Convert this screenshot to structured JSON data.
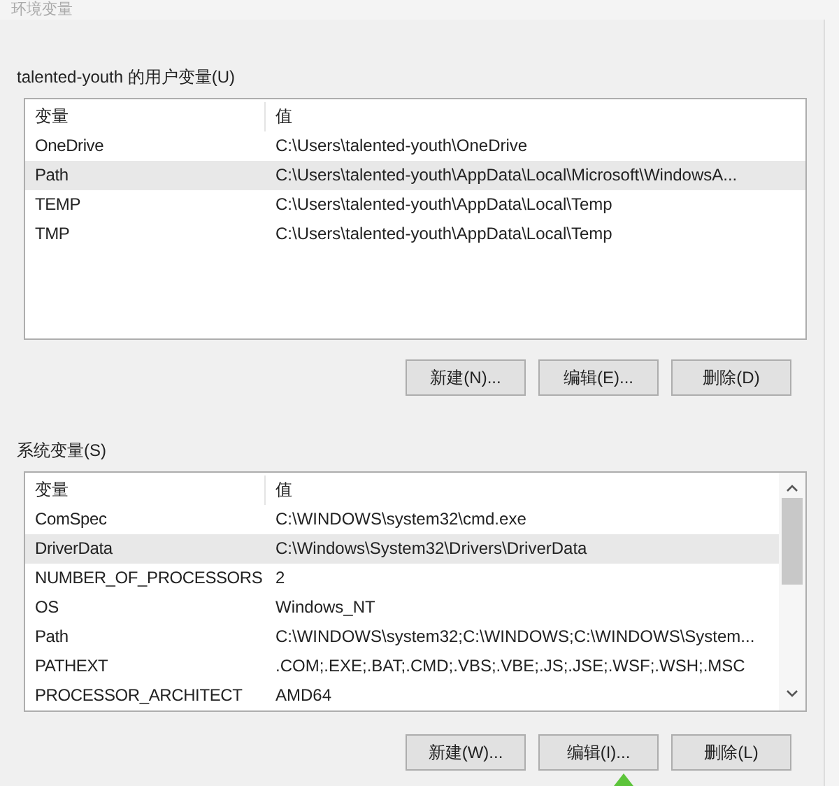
{
  "window": {
    "title": "环境变量"
  },
  "user_variables": {
    "label": "talented-youth 的用户变量(U)",
    "columns": [
      "变量",
      "值"
    ],
    "rows": [
      {
        "name": "OneDrive",
        "value": "C:\\Users\\talented-youth\\OneDrive",
        "selected": false
      },
      {
        "name": "Path",
        "value": "C:\\Users\\talented-youth\\AppData\\Local\\Microsoft\\WindowsA...",
        "selected": true
      },
      {
        "name": "TEMP",
        "value": "C:\\Users\\talented-youth\\AppData\\Local\\Temp",
        "selected": false
      },
      {
        "name": "TMP",
        "value": "C:\\Users\\talented-youth\\AppData\\Local\\Temp",
        "selected": false
      }
    ],
    "buttons": [
      "新建(N)...",
      "编辑(E)...",
      "删除(D)"
    ]
  },
  "system_variables": {
    "label": "系统变量(S)",
    "columns": [
      "变量",
      "值"
    ],
    "rows": [
      {
        "name": "ComSpec",
        "value": "C:\\WINDOWS\\system32\\cmd.exe",
        "selected": false
      },
      {
        "name": "DriverData",
        "value": "C:\\Windows\\System32\\Drivers\\DriverData",
        "selected": true
      },
      {
        "name": "NUMBER_OF_PROCESSORS",
        "value": "2",
        "selected": false
      },
      {
        "name": "OS",
        "value": "Windows_NT",
        "selected": false
      },
      {
        "name": "Path",
        "value": "C:\\WINDOWS\\system32;C:\\WINDOWS;C:\\WINDOWS\\System...",
        "selected": false
      },
      {
        "name": "PATHEXT",
        "value": ".COM;.EXE;.BAT;.CMD;.VBS;.VBE;.JS;.JSE;.WSF;.WSH;.MSC",
        "selected": false
      },
      {
        "name": "PROCESSOR_ARCHITECT",
        "value": "AMD64",
        "selected": false
      }
    ],
    "buttons": [
      "新建(W)...",
      "编辑(I)...",
      "删除(L)"
    ]
  }
}
